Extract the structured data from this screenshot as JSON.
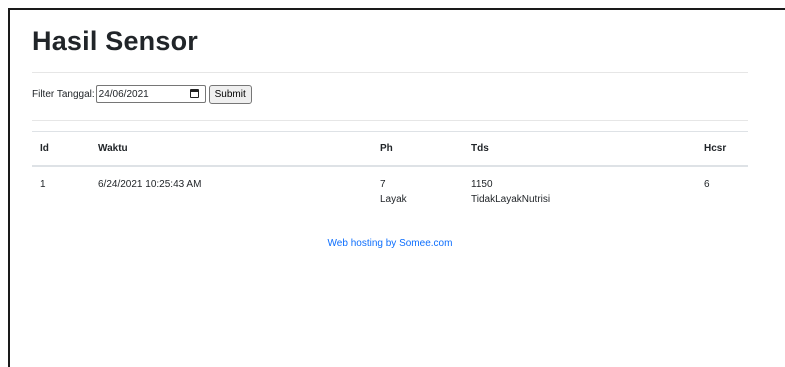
{
  "page": {
    "title": "Hasil Sensor"
  },
  "filter": {
    "label": "Filter Tanggal:",
    "date_value": "24/06/2021",
    "submit_label": "Submit"
  },
  "table": {
    "headers": [
      "Id",
      "Waktu",
      "Ph",
      "Tds",
      "Hcsr"
    ],
    "rows": [
      {
        "id": "1",
        "waktu": "6/24/2021 10:25:43 AM",
        "ph": "7",
        "ph_status": "Layak",
        "tds": "1150",
        "tds_status": "TidakLayakNutrisi",
        "hcsr": "6"
      }
    ]
  },
  "footer": {
    "link_text": "Web hosting by Somee.com"
  }
}
